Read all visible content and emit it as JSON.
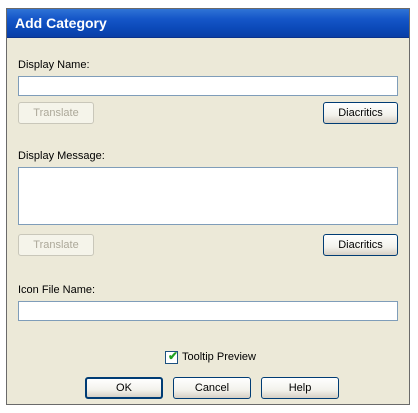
{
  "dialog": {
    "title": "Add Category"
  },
  "display_name": {
    "label": "Display Name:",
    "value": "",
    "translate_label": "Translate",
    "diacritics_label": "Diacritics"
  },
  "display_message": {
    "label": "Display Message:",
    "value": "",
    "translate_label": "Translate",
    "diacritics_label": "Diacritics"
  },
  "icon_file": {
    "label": "Icon File Name:",
    "value": ""
  },
  "tooltip_preview": {
    "label": "Tooltip Preview",
    "checked": true
  },
  "footer": {
    "ok_label": "OK",
    "cancel_label": "Cancel",
    "help_label": "Help"
  },
  "colors": {
    "titlebar": "#0b49b8",
    "dialog_bg": "#ece9d8",
    "field_border": "#7f9db9",
    "check_mark": "#21a121"
  }
}
